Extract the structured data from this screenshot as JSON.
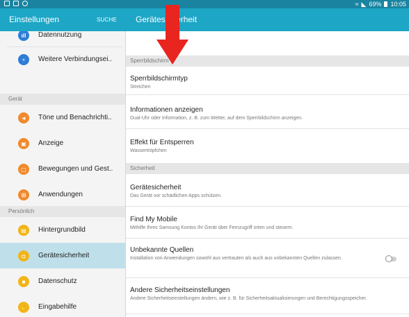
{
  "status": {
    "signal": "┆",
    "battery_pct": "69%",
    "time": "10:05"
  },
  "appbar": {
    "title": "Einstellungen",
    "search": "SUCHE",
    "detail_title": "Gerätesicherheit",
    "color": "#1da6c5"
  },
  "sidebar": {
    "items_top": [
      {
        "label": "Datennutzung",
        "icon": "data-usage-icon",
        "color": "#2e7dd6",
        "glyph": "ıll"
      },
      {
        "label": "Weitere Verbindungsei..",
        "icon": "more-connections-icon",
        "color": "#2e7dd6",
        "glyph": "⚬"
      }
    ],
    "heading_device": "Gerät",
    "items_device": [
      {
        "label": "Töne und Benachrichti..",
        "icon": "sound-icon",
        "color": "#f08a2c",
        "glyph": "◄"
      },
      {
        "label": "Anzeige",
        "icon": "display-icon",
        "color": "#f08a2c",
        "glyph": "▣"
      },
      {
        "label": "Bewegungen und Gest..",
        "icon": "motion-icon",
        "color": "#f08a2c",
        "glyph": "▢"
      },
      {
        "label": "Anwendungen",
        "icon": "apps-icon",
        "color": "#f08a2c",
        "glyph": "⊞"
      }
    ],
    "heading_personal": "Persönlich",
    "items_personal": [
      {
        "label": "Hintergrundbild",
        "icon": "wallpaper-icon",
        "color": "#f2b517",
        "glyph": "▤"
      },
      {
        "label": "Gerätesicherheit",
        "icon": "lock-icon",
        "color": "#f2b517",
        "glyph": "◘"
      },
      {
        "label": "Datenschutz",
        "icon": "privacy-icon",
        "color": "#f2b517",
        "glyph": "■"
      },
      {
        "label": "Eingabehilfe",
        "icon": "accessibility-icon",
        "color": "#f2b517",
        "glyph": "✋"
      }
    ]
  },
  "main": {
    "heading_lock": "Sperrbildschirm",
    "lock_type": {
      "title": "Sperrbildschirmtyp",
      "sub": "Streichen"
    },
    "show_info": {
      "title": "Informationen anzeigen",
      "sub": "Dual-Uhr oder Information, z. B. zum Wetter, auf dem Sperrbildschirm anzeigen."
    },
    "unlock_effect": {
      "title": "Effekt für Entsperren",
      "sub": "Wassertröpfchen"
    },
    "heading_security": "Sicherheit",
    "device_security": {
      "title": "Gerätesicherheit",
      "sub": "Das Gerät vor schädlichen Apps schützen."
    },
    "find_my_mobile": {
      "title": "Find My Mobile",
      "sub": "Mithilfe Ihres Samsung Kontos Ihr Gerät über Fernzugriff orten und steuern."
    },
    "unknown_sources": {
      "title": "Unbekannte Quellen",
      "sub": "Installation von Anwendungen sowohl aus vertrauten als auch aus unbekannten Quellen zulassen.",
      "enabled": false
    },
    "other_security": {
      "title": "Andere Sicherheitseinstellungen",
      "sub": "Andere Sicherheitseinstellungen ändern, wie z. B. für Sicherheitsaktualisierungen und Berechtigungsspeicher."
    }
  },
  "annotation": {
    "color": "#e8251f"
  }
}
